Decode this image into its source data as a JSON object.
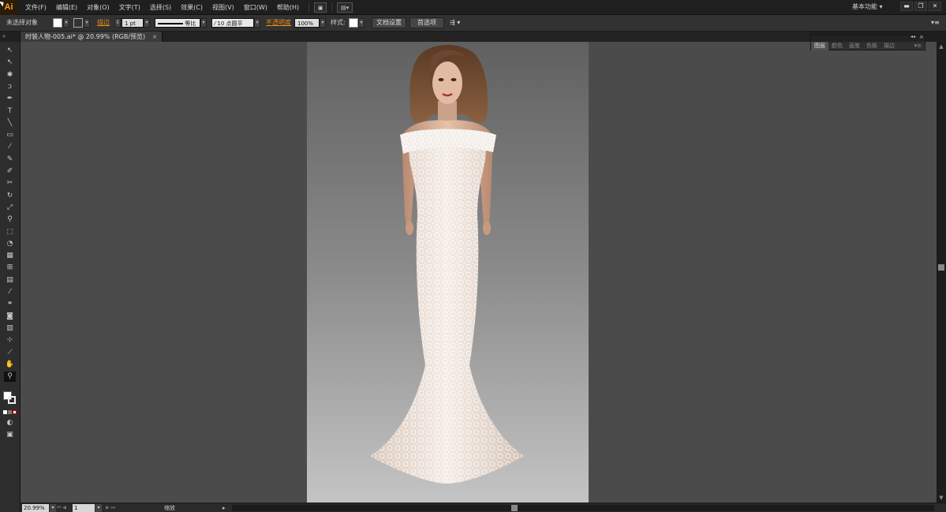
{
  "app": {
    "logo": "Ai"
  },
  "menu": [
    "文件(F)",
    "编辑(E)",
    "对象(O)",
    "文字(T)",
    "选择(S)",
    "效果(C)",
    "视图(V)",
    "窗口(W)",
    "帮助(H)"
  ],
  "workspace": {
    "label": "基本功能",
    "chevron": "▾"
  },
  "window_buttons": [
    "▬",
    "❐",
    "✕"
  ],
  "controlbar": {
    "selection": "未选择对象",
    "stroke_label": "描边",
    "stroke_value": "1 pt",
    "profile": "等比",
    "brush": "10 点圆平",
    "opacity_label": "不透明度",
    "opacity_value": "100%",
    "style_label": "样式:",
    "doc_setup": "文档设置",
    "preferences": "首选项"
  },
  "document_tab": {
    "title": "时装人物-005.ai* @ 20.99% (RGB/预览)",
    "close": "×"
  },
  "toolbox": {
    "collapse": "»",
    "tools": [
      {
        "name": "selection-tool-icon",
        "glyph": "↖"
      },
      {
        "name": "direct-selection-tool-icon",
        "glyph": "↖"
      },
      {
        "name": "magic-wand-tool-icon",
        "glyph": "✱"
      },
      {
        "name": "lasso-tool-icon",
        "glyph": "ↄ"
      },
      {
        "name": "pen-tool-icon",
        "glyph": "✒"
      },
      {
        "name": "type-tool-icon",
        "glyph": "T"
      },
      {
        "name": "line-tool-icon",
        "glyph": "╲"
      },
      {
        "name": "rectangle-tool-icon",
        "glyph": "▭"
      },
      {
        "name": "paintbrush-tool-icon",
        "glyph": "⁄"
      },
      {
        "name": "pencil-tool-icon",
        "glyph": "✎"
      },
      {
        "name": "blob-brush-tool-icon",
        "glyph": "✐"
      },
      {
        "name": "scissors-tool-icon",
        "glyph": "✂"
      },
      {
        "name": "rotate-tool-icon",
        "glyph": "↻"
      },
      {
        "name": "scale-tool-icon",
        "glyph": "⤢"
      },
      {
        "name": "warp-tool-icon",
        "glyph": "⚲"
      },
      {
        "name": "free-transform-tool-icon",
        "glyph": "⬚"
      },
      {
        "name": "shape-builder-tool-icon",
        "glyph": "◔"
      },
      {
        "name": "perspective-grid-tool-icon",
        "glyph": "▦"
      },
      {
        "name": "mesh-tool-icon",
        "glyph": "⊞"
      },
      {
        "name": "gradient-tool-icon",
        "glyph": "▤"
      },
      {
        "name": "eyedropper-tool-icon",
        "glyph": "⁄"
      },
      {
        "name": "blend-tool-icon",
        "glyph": "⚭"
      },
      {
        "name": "symbol-sprayer-tool-icon",
        "glyph": "◙"
      },
      {
        "name": "column-graph-tool-icon",
        "glyph": "▥"
      },
      {
        "name": "artboard-tool-icon",
        "glyph": "⊹"
      },
      {
        "name": "slice-tool-icon",
        "glyph": "⟋"
      },
      {
        "name": "hand-tool-icon",
        "glyph": "✋"
      },
      {
        "name": "zoom-tool-icon",
        "glyph": "⚲"
      }
    ]
  },
  "panel": {
    "tabs": [
      "图层",
      "颜色",
      "画笔",
      "色板",
      "描边"
    ],
    "collapse": "◂◂",
    "close": "×",
    "menu": "▾≡"
  },
  "status": {
    "zoom": "20.99%",
    "page": "1",
    "tool": "缩放"
  }
}
